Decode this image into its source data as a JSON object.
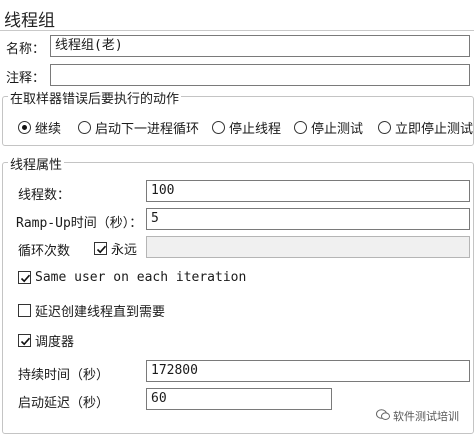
{
  "title": "线程组",
  "name_field": {
    "label": "名称：",
    "value": "线程组(老)"
  },
  "comment_field": {
    "label": "注释：",
    "value": ""
  },
  "error_action": {
    "legend": "在取样器错误后要执行的动作",
    "options": [
      {
        "label": "继续",
        "selected": true
      },
      {
        "label": "启动下一进程循环",
        "selected": false
      },
      {
        "label": "停止线程",
        "selected": false
      },
      {
        "label": "停止测试",
        "selected": false
      },
      {
        "label": "立即停止测试",
        "selected": false
      }
    ]
  },
  "thread_props": {
    "legend": "线程属性",
    "threads": {
      "label": "线程数：",
      "value": "100"
    },
    "rampup": {
      "label": "Ramp-Up时间（秒）：",
      "value": "5"
    },
    "loop": {
      "label": "循环次数",
      "forever_label": "永远",
      "forever_checked": true,
      "value": ""
    },
    "same_user": {
      "label": "Same user on each iteration",
      "checked": true
    },
    "delay_create": {
      "label": "延迟创建线程直到需要",
      "checked": false
    },
    "scheduler": {
      "label": "调度器",
      "checked": true
    },
    "duration": {
      "label": "持续时间（秒）",
      "value": "172800"
    },
    "startup_delay": {
      "label": "启动延迟（秒）",
      "value": "60"
    }
  },
  "watermark": {
    "text": "软件测试培训",
    "icon": "wechat-icon"
  }
}
